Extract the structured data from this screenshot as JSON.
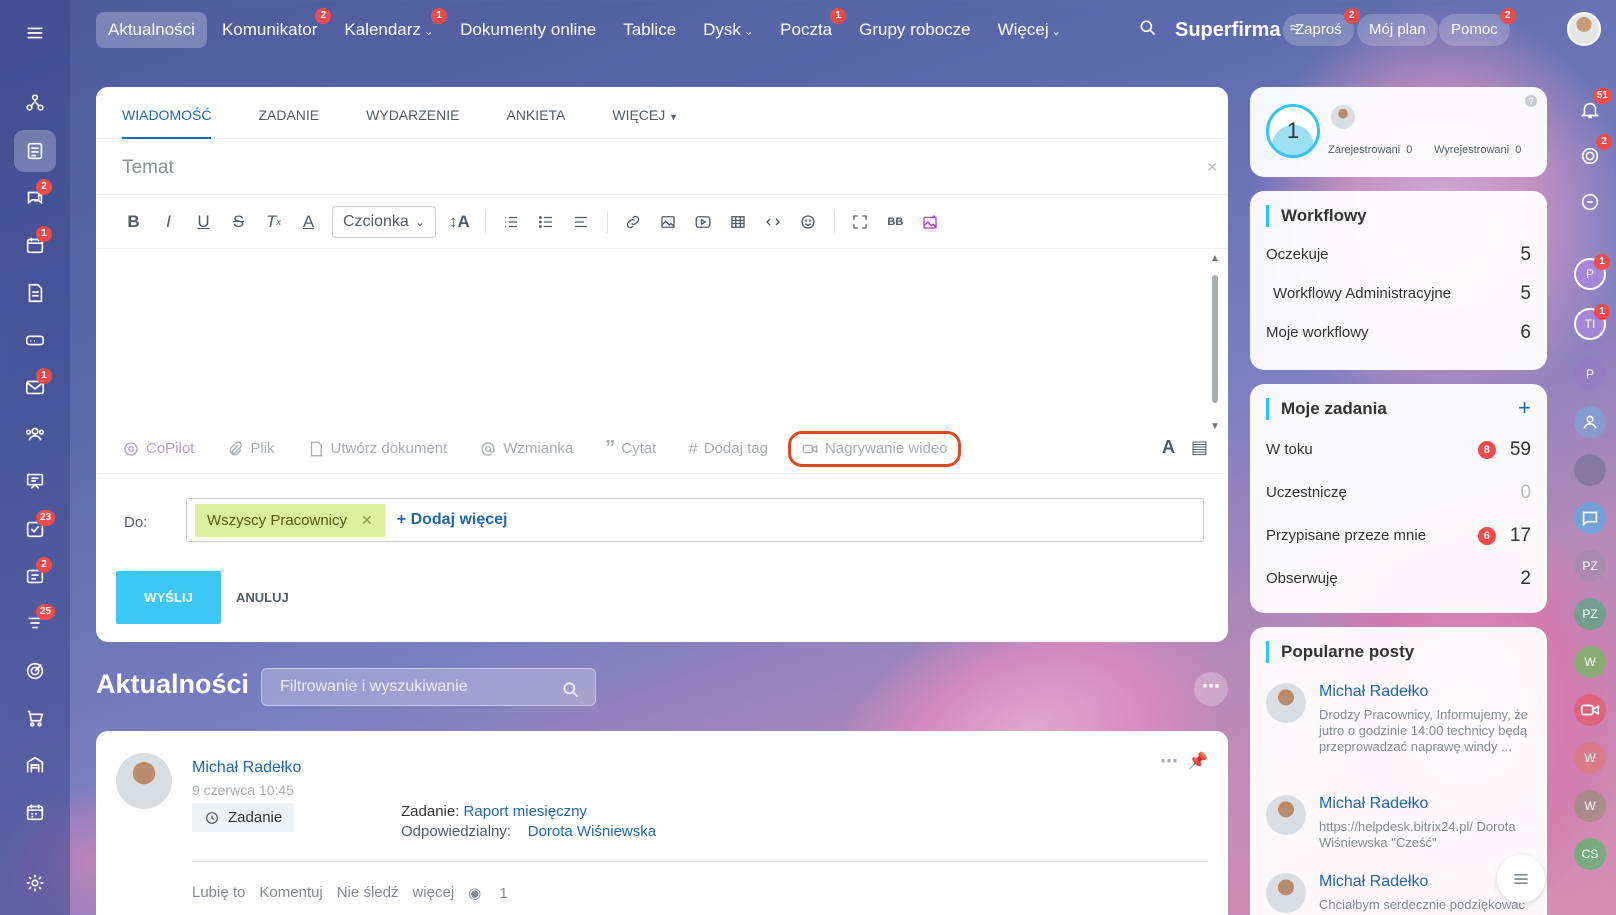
{
  "nav": {
    "items": [
      {
        "label": "Aktualności",
        "active": true,
        "badge": ""
      },
      {
        "label": "Komunikator",
        "badge": "2"
      },
      {
        "label": "Kalendarz",
        "badge": "1",
        "chevron": true
      },
      {
        "label": "Dokumenty online",
        "badge": ""
      },
      {
        "label": "Tablice",
        "badge": ""
      },
      {
        "label": "Dysk",
        "badge": "",
        "chevron": true
      },
      {
        "label": "Poczta",
        "badge": "1"
      },
      {
        "label": "Grupy robocze",
        "badge": ""
      },
      {
        "label": "Więcej",
        "badge": "",
        "chevron": true
      }
    ],
    "brand": "Superfirma",
    "invite_label": "Zaproś",
    "invite_badge": "2",
    "plan_label": "Mój plan",
    "help_label": "Pomoc",
    "help_badge": "2"
  },
  "left_sidebar": {
    "badges": {
      "chat": "2",
      "calendar": "1",
      "mail": "1",
      "tasks": "23",
      "feed": "2",
      "filter": "25"
    }
  },
  "right_bar": {
    "notif_badge": "51",
    "pulse_badge": "2",
    "avatars": [
      {
        "initials": "P",
        "badge": "1"
      },
      {
        "initials": "TI",
        "badge": "1"
      },
      {
        "initials": "P",
        "badge": ""
      },
      {
        "initials": "PZ",
        "badge": ""
      },
      {
        "initials": "PZ",
        "badge": ""
      },
      {
        "initials": "W",
        "badge": ""
      },
      {
        "initials": "W",
        "badge": ""
      },
      {
        "initials": "W",
        "badge": ""
      },
      {
        "initials": "CS",
        "badge": ""
      }
    ]
  },
  "editor": {
    "tabs": [
      "WIADOMOŚĆ",
      "ZADANIE",
      "WYDARZENIE",
      "ANKIETA",
      "WIĘCEJ"
    ],
    "subject_placeholder": "Temat",
    "font_select": "Czcionka",
    "actions": {
      "copilot": "CoPilot",
      "file": "Plik",
      "create_doc": "Utwórz dokument",
      "mention": "Wzmianka",
      "quote": "Cytat",
      "tag": "Dodaj tag",
      "video": "Nagrywanie wideo"
    },
    "to_label": "Do:",
    "recipient": "Wszyscy Pracownicy",
    "add_more": "Dodaj więcej",
    "send": "WYŚLIJ",
    "cancel": "ANULUJ"
  },
  "feed": {
    "title": "Aktualności",
    "filter_placeholder": "Filtrowanie i wyszukiwanie",
    "post": {
      "author": "Michał Radełko",
      "date": "9 czerwca 10:45",
      "chip": "Zadanie",
      "task_label": "Zadanie:",
      "task_name": "Raport miesięczny",
      "resp_label": "Odpowiedzialny:",
      "resp_name": "Dorota Wiśniewska",
      "like": "Lubię to",
      "comment": "Komentuj",
      "unfollow": "Nie śledź",
      "more": "więcej",
      "views": "1"
    }
  },
  "timeman": {
    "count": "1",
    "registered_label": "Zarejestrowani",
    "registered": "0",
    "unregistered_label": "Wyrejestrowani",
    "unregistered": "0"
  },
  "workflows": {
    "title": "Workflowy",
    "rows": [
      {
        "label": "Oczekuje",
        "value": "5"
      },
      {
        "label": "Workflowy Administracyjne",
        "value": "5"
      },
      {
        "label": "Moje workflowy",
        "value": "6"
      }
    ]
  },
  "tasks": {
    "title": "Moje zadania",
    "rows": [
      {
        "label": "W toku",
        "badge": "8",
        "value": "59"
      },
      {
        "label": "Uczestniczę",
        "badge": "",
        "value": "0"
      },
      {
        "label": "Przypisane przeze mnie",
        "badge": "6",
        "value": "17"
      },
      {
        "label": "Obserwuję",
        "badge": "",
        "value": "2"
      }
    ]
  },
  "popular": {
    "title": "Popularne posty",
    "items": [
      {
        "name": "Michał Radełko",
        "text": "Drodzy Pracownicy, Informujemy, że jutro o godzinie 14:00 technicy będą przeprowadzać naprawę windy ..."
      },
      {
        "name": "Michał Radełko",
        "text": "https://helpdesk.bitrix24.pl/ Dorota Wiśniewska \"Cześć\""
      },
      {
        "name": "Michał Radełko",
        "text": "Chciałbym serdecznie podziękować"
      }
    ]
  }
}
